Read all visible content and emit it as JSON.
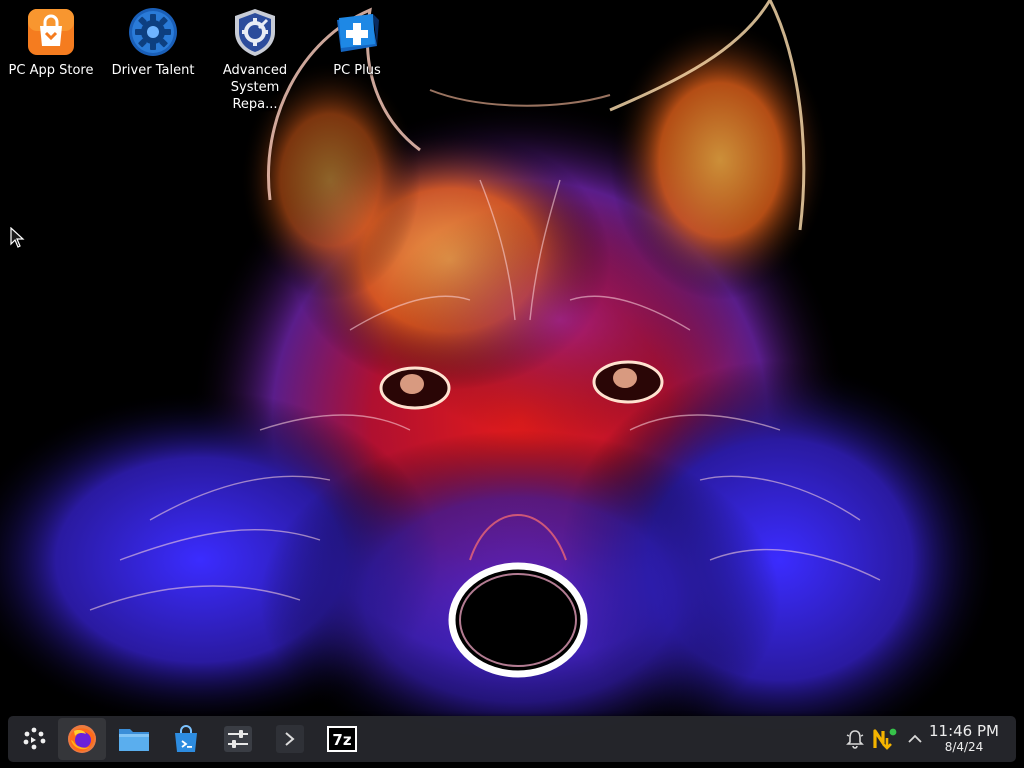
{
  "desktop": {
    "wallpaper": "glowing-wolf-wallpaper",
    "icons": [
      {
        "label": "PC App Store",
        "icon": "shopping-bag-icon",
        "color": "#f57c1f"
      },
      {
        "label": "Driver Talent",
        "icon": "gear-icon",
        "color": "#2a7bd8"
      },
      {
        "label": "Advanced System Repa...",
        "icon": "shield-gear-icon",
        "color": "#2c4c9c"
      },
      {
        "label": "PC Plus",
        "icon": "medical-cross-icon",
        "color": "#1e88e5"
      }
    ]
  },
  "taskbar": {
    "launcher": {
      "icon": "app-launcher-icon"
    },
    "apps": [
      {
        "name": "Firefox",
        "icon": "firefox-icon"
      },
      {
        "name": "Files",
        "icon": "folder-icon"
      },
      {
        "name": "Store",
        "icon": "shopping-bag-icon"
      },
      {
        "name": "Settings",
        "icon": "sliders-icon"
      },
      {
        "name": "Terminal",
        "icon": "terminal-icon"
      },
      {
        "name": "7-Zip",
        "icon": "seven-zip-icon",
        "text": "7z"
      }
    ],
    "tray": [
      {
        "icon": "notification-bell-icon"
      },
      {
        "icon": "updates-icon"
      },
      {
        "icon": "chevron-up-icon"
      }
    ],
    "clock": {
      "time": "11:46 PM",
      "date": "8/4/24"
    }
  }
}
